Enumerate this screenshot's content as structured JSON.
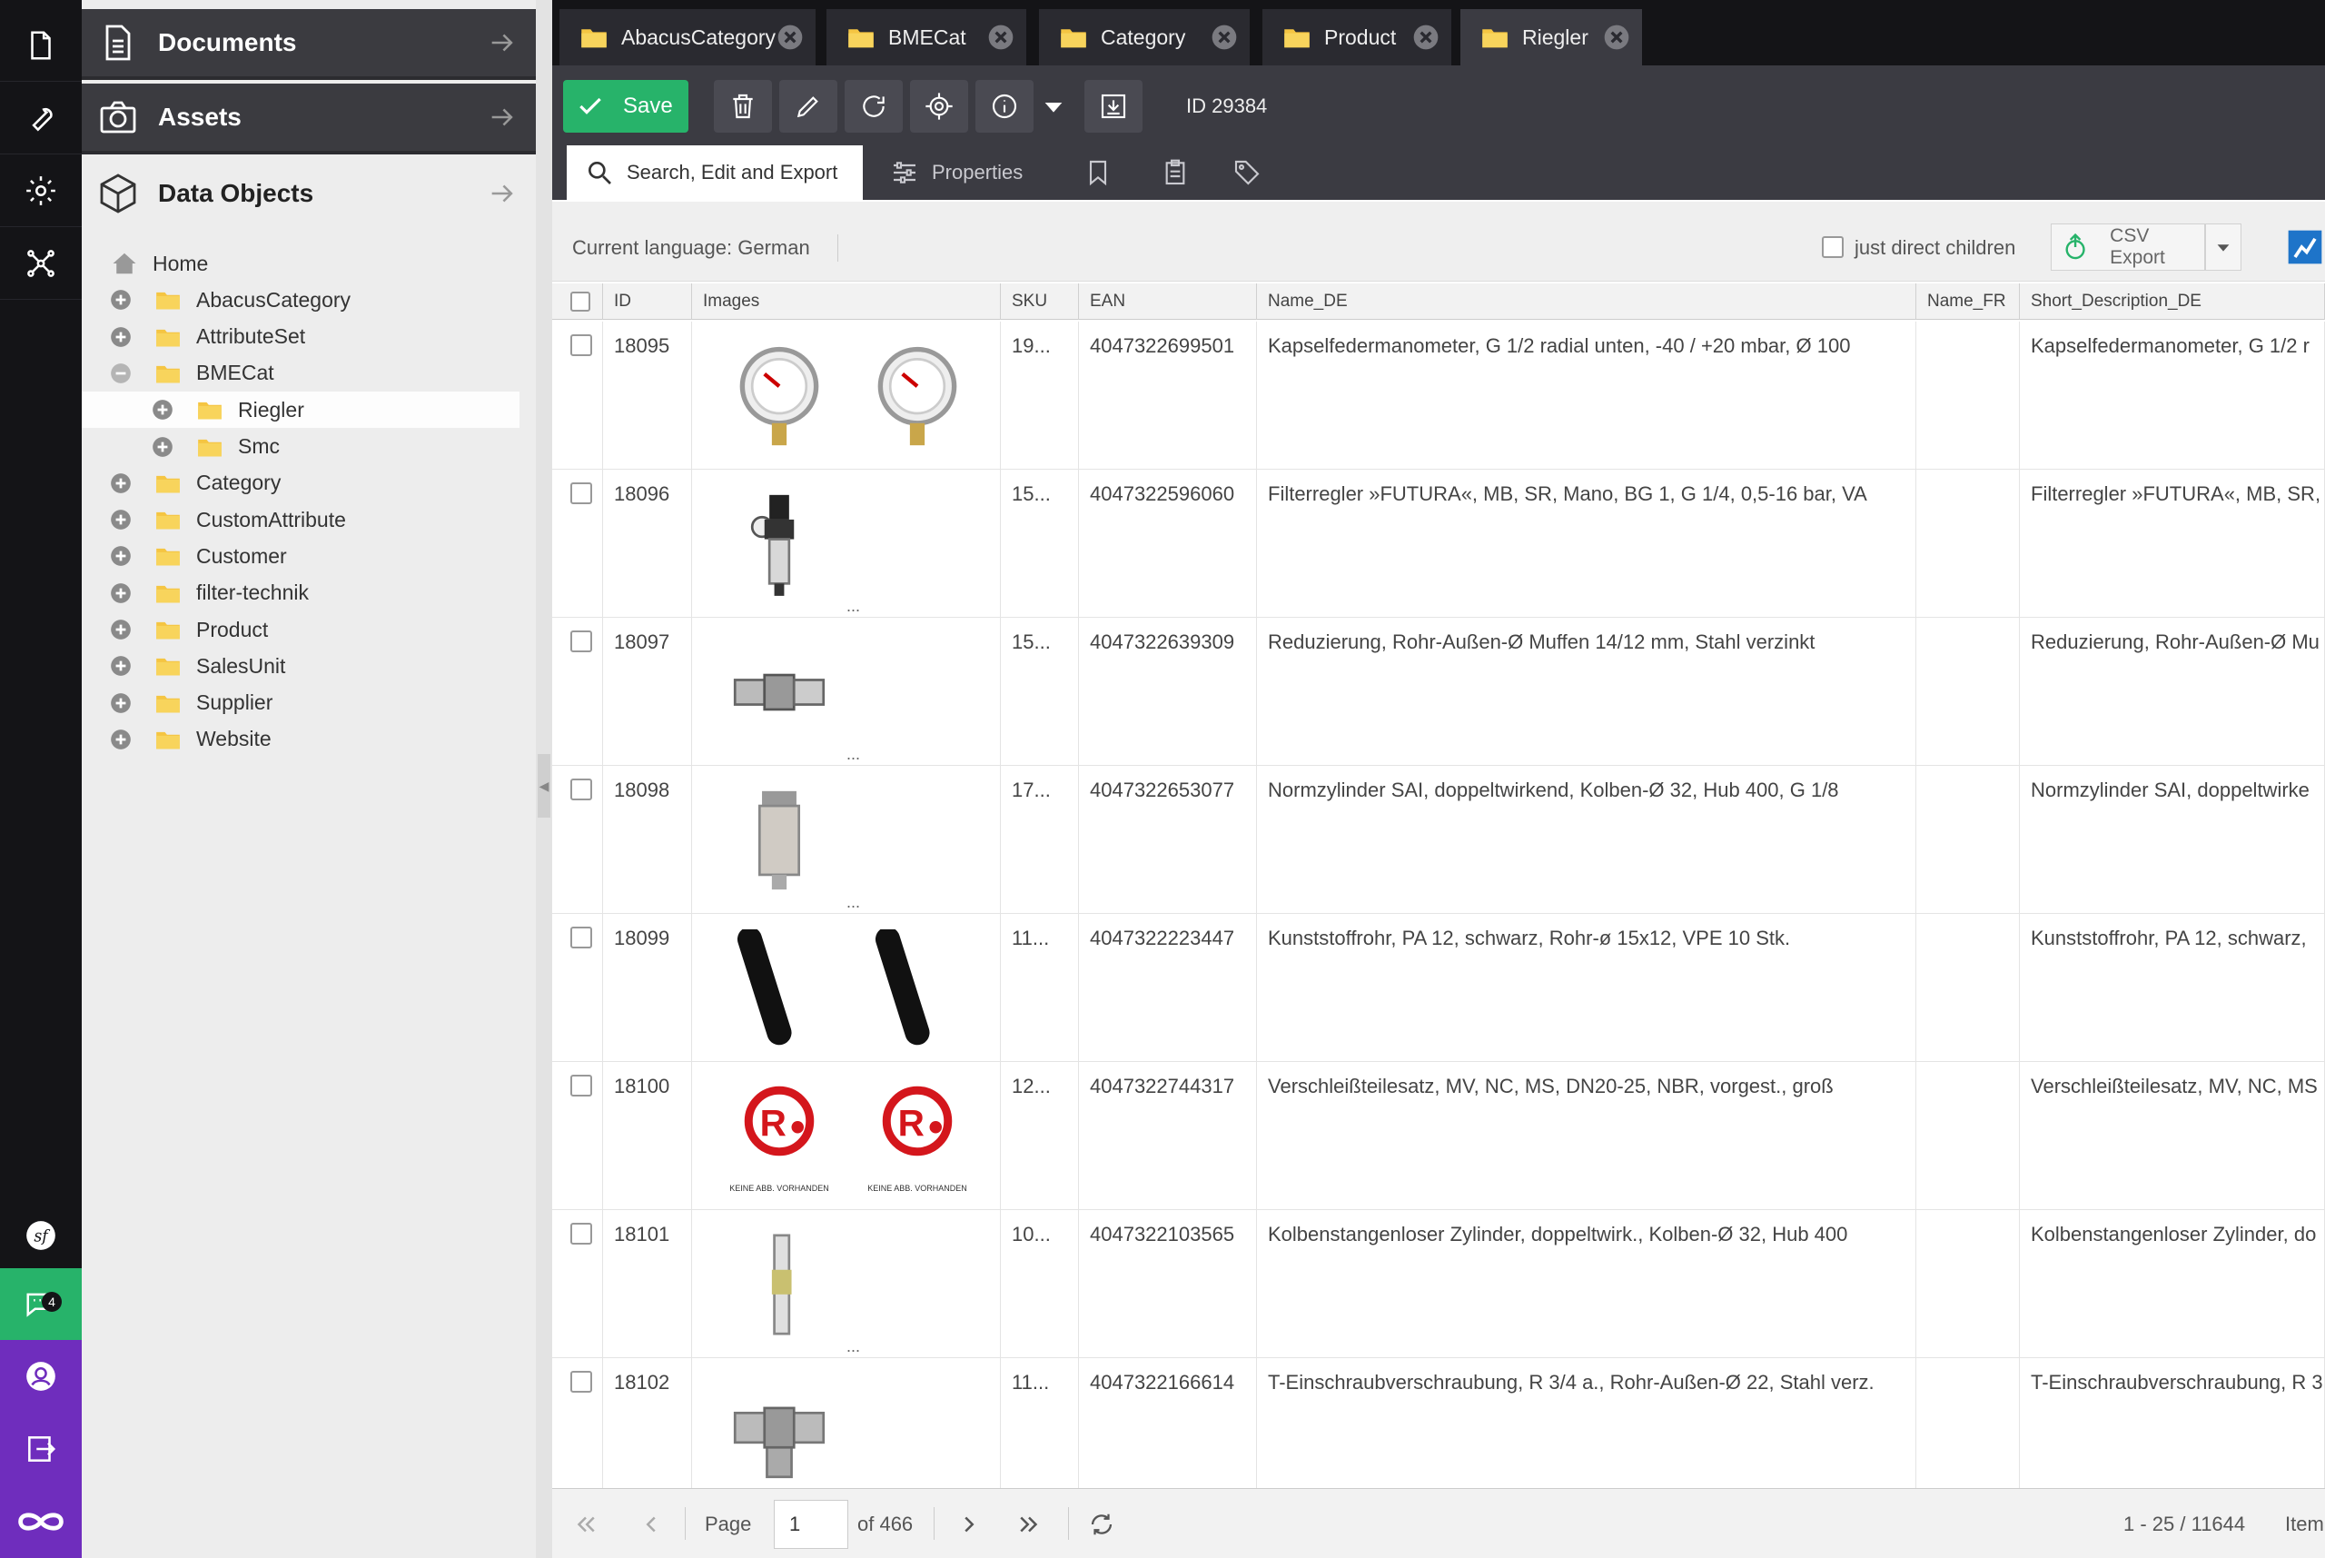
{
  "sidebar": {
    "documents": "Documents",
    "assets": "Assets",
    "data_objects": "Data Objects",
    "chat_badge": "4",
    "tree": [
      {
        "label": "Home",
        "level": 0,
        "type": "home"
      },
      {
        "label": "AbacusCategory",
        "level": 0,
        "type": "folder",
        "expander": "plus"
      },
      {
        "label": "AttributeSet",
        "level": 0,
        "type": "folder",
        "expander": "plus"
      },
      {
        "label": "BMECat",
        "level": 0,
        "type": "folder",
        "expander": "minus"
      },
      {
        "label": "Riegler",
        "level": 1,
        "type": "folder",
        "expander": "plus",
        "selected": true
      },
      {
        "label": "Smc",
        "level": 1,
        "type": "folder",
        "expander": "plus"
      },
      {
        "label": "Category",
        "level": 0,
        "type": "folder",
        "expander": "plus"
      },
      {
        "label": "CustomAttribute",
        "level": 0,
        "type": "folder",
        "expander": "plus"
      },
      {
        "label": "Customer",
        "level": 0,
        "type": "folder",
        "expander": "plus"
      },
      {
        "label": "filter-technik",
        "level": 0,
        "type": "folder",
        "expander": "plus"
      },
      {
        "label": "Product",
        "level": 0,
        "type": "folder",
        "expander": "plus"
      },
      {
        "label": "SalesUnit",
        "level": 0,
        "type": "folder",
        "expander": "plus"
      },
      {
        "label": "Supplier",
        "level": 0,
        "type": "folder",
        "expander": "plus"
      },
      {
        "label": "Website",
        "level": 0,
        "type": "folder",
        "expander": "plus"
      }
    ]
  },
  "tabs": [
    {
      "label": "AbacusCategory"
    },
    {
      "label": "BMECat"
    },
    {
      "label": "Category"
    },
    {
      "label": "Product"
    },
    {
      "label": "Riegler",
      "active": true
    }
  ],
  "toolbar": {
    "save_label": "Save",
    "id_label": "ID 29384"
  },
  "subtabs": {
    "search": "Search, Edit and Export",
    "properties": "Properties"
  },
  "grid_toolbar": {
    "language": "Current language: German",
    "direct_children": "just direct children",
    "csv_export": "CSV Export"
  },
  "columns": [
    "ID",
    "Images",
    "SKU",
    "EAN",
    "Name_DE",
    "Name_FR",
    "Short_Description_DE"
  ],
  "rows": [
    {
      "id": "18095",
      "sku": "19...",
      "ean": "4047322699501",
      "name_de": "Kapselfedermanometer, G 1/2 radial unten, -40 / +20 mbar, Ø 100",
      "name_fr": "",
      "short_de": "Kapselfedermanometer, G 1/2 r",
      "images": [
        "gauge-icon",
        "gauge-icon"
      ],
      "more": ""
    },
    {
      "id": "18096",
      "sku": "15...",
      "ean": "4047322596060",
      "name_de": "Filterregler »FUTURA«, MB, SR, Mano, BG 1, G 1/4, 0,5-16 bar, VA",
      "name_fr": "",
      "short_de": "Filterregler »FUTURA«, MB, SR,",
      "images": [
        "filter-regulator-icon"
      ],
      "more": "..."
    },
    {
      "id": "18097",
      "sku": "15...",
      "ean": "4047322639309",
      "name_de": "Reduzierung, Rohr-Außen-Ø Muffen 14/12 mm, Stahl verzinkt",
      "name_fr": "",
      "short_de": "Reduzierung, Rohr-Außen-Ø Mu",
      "images": [
        "reducer-fitting-icon"
      ],
      "more": "..."
    },
    {
      "id": "18098",
      "sku": "17...",
      "ean": "4047322653077",
      "name_de": "Normzylinder SAI, doppeltwirkend, Kolben-Ø 32, Hub 400, G 1/8",
      "name_fr": "",
      "short_de": "Normzylinder SAI, doppeltwirke",
      "images": [
        "cylinder-icon"
      ],
      "more": "..."
    },
    {
      "id": "18099",
      "sku": "11...",
      "ean": "4047322223447",
      "name_de": "Kunststoffrohr, PA 12, schwarz, Rohr-ø 15x12, VPE 10 Stk.",
      "name_fr": "",
      "short_de": "Kunststoffrohr, PA 12, schwarz,",
      "images": [
        "tube-icon",
        "tube-icon"
      ],
      "more": ""
    },
    {
      "id": "18100",
      "sku": "12...",
      "ean": "4047322744317",
      "name_de": "Verschleißteilesatz, MV, NC, MS, DN20-25, NBR, vorgest., groß",
      "name_fr": "",
      "short_de": "Verschleißteilesatz, MV, NC, MS",
      "images": [
        "no-image-logo",
        "no-image-logo"
      ],
      "more": ""
    },
    {
      "id": "18101",
      "sku": "10...",
      "ean": "4047322103565",
      "name_de": "Kolbenstangenloser Zylinder, doppeltwirk., Kolben-Ø 32, Hub 400",
      "name_fr": "",
      "short_de": "Kolbenstangenloser Zylinder, do",
      "images": [
        "rodless-cylinder-icon"
      ],
      "more": "..."
    },
    {
      "id": "18102",
      "sku": "11...",
      "ean": "4047322166614",
      "name_de": "T-Einschraubverschraubung, R 3/4 a., Rohr-Außen-Ø 22, Stahl verz.",
      "name_fr": "",
      "short_de": "T-Einschraubverschraubung, R 3",
      "images": [
        "tee-fitting-icon"
      ],
      "more": ""
    }
  ],
  "placeholder_caption": "KEINE ABB. VORHANDEN",
  "pager": {
    "page_label": "Page",
    "page_value": "1",
    "of_label": "of 466",
    "count_label": "1 - 25 / 11644",
    "items_label": "Item"
  },
  "colors": {
    "accent_green": "#27b36a",
    "folder_yellow": "#f5c542",
    "rail_purple": "#6f2dbd",
    "brand_red": "#d4161c"
  }
}
